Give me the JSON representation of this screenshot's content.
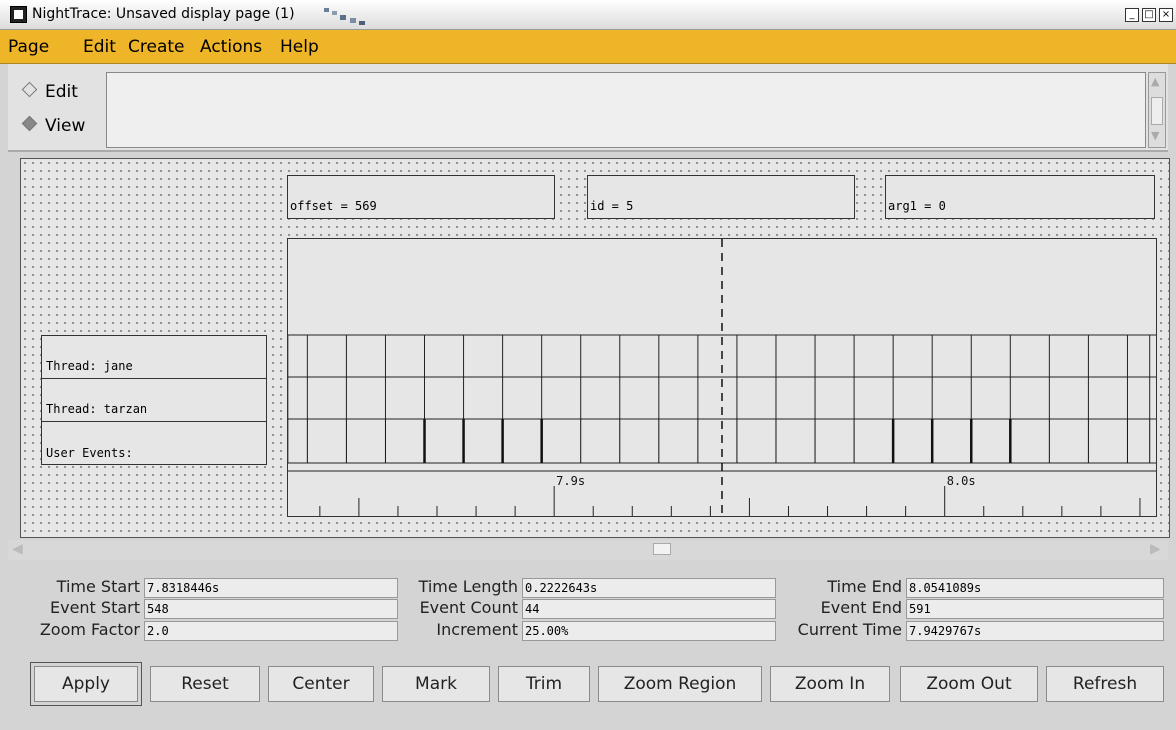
{
  "window": {
    "title": "NightTrace: Unsaved display page (1)",
    "controls": [
      "_",
      "□",
      "×"
    ]
  },
  "menu": [
    "Page",
    "Edit",
    "Create",
    "Actions",
    "Help"
  ],
  "mode": {
    "edit_label": "Edit",
    "view_label": "View",
    "selected": "View"
  },
  "info_boxes": {
    "offset": "offset = 569",
    "id": "id = 5",
    "arg1": "arg1 = 0"
  },
  "rows": [
    "Thread: jane",
    "Thread: tarzan",
    "User Events:"
  ],
  "timeline": {
    "ticks": [
      "7.9s",
      "8.0s"
    ],
    "time_start": 7.8318446,
    "time_end": 8.0541089,
    "current_time": 7.9429767,
    "jane_events": [
      7.8318,
      7.8368,
      7.8468,
      7.8568,
      7.8668,
      7.8768,
      7.8868,
      7.8968,
      7.9068,
      7.9168,
      7.9268,
      7.9368,
      7.9468,
      7.9568,
      7.9668,
      7.9768,
      7.9868,
      7.9968,
      8.0068,
      8.0168,
      8.0268,
      8.0368,
      8.0468,
      8.0525
    ],
    "tarzan_events": [
      7.8318,
      7.8368,
      7.8468,
      7.8568,
      7.8668,
      7.8768,
      7.8868,
      7.8968,
      7.9068,
      7.9168,
      7.9268,
      7.9368,
      7.9468,
      7.9568,
      7.9668,
      7.9768,
      7.9868,
      7.9968,
      8.0068,
      8.0168,
      8.0268,
      8.0368,
      8.0468,
      8.0525
    ],
    "user_events": [
      {
        "t": 7.8318,
        "bold": false
      },
      {
        "t": 7.8368,
        "bold": false
      },
      {
        "t": 7.8468,
        "bold": false
      },
      {
        "t": 7.8568,
        "bold": false
      },
      {
        "t": 7.8668,
        "bold": true
      },
      {
        "t": 7.8768,
        "bold": true
      },
      {
        "t": 7.8868,
        "bold": true
      },
      {
        "t": 7.8968,
        "bold": true
      },
      {
        "t": 7.9068,
        "bold": false
      },
      {
        "t": 7.9168,
        "bold": false
      },
      {
        "t": 7.9268,
        "bold": false
      },
      {
        "t": 7.9368,
        "bold": false
      },
      {
        "t": 7.9468,
        "bold": false
      },
      {
        "t": 7.9568,
        "bold": false
      },
      {
        "t": 7.9668,
        "bold": false
      },
      {
        "t": 7.9768,
        "bold": false
      },
      {
        "t": 7.9868,
        "bold": true
      },
      {
        "t": 7.9968,
        "bold": true
      },
      {
        "t": 8.0068,
        "bold": true
      },
      {
        "t": 8.0168,
        "bold": true
      },
      {
        "t": 8.0268,
        "bold": false
      },
      {
        "t": 8.0368,
        "bold": false
      },
      {
        "t": 8.0468,
        "bold": false
      },
      {
        "t": 8.0525,
        "bold": false
      }
    ]
  },
  "fields": {
    "time_start": {
      "label": "Time Start",
      "value": "7.8318446s"
    },
    "event_start": {
      "label": "Event Start",
      "value": "548"
    },
    "zoom_factor": {
      "label": "Zoom Factor",
      "value": "2.0"
    },
    "time_length": {
      "label": "Time Length",
      "value": "0.2222643s"
    },
    "event_count": {
      "label": "Event Count",
      "value": "44"
    },
    "increment": {
      "label": "Increment",
      "value": "25.00%"
    },
    "time_end": {
      "label": "Time End",
      "value": "8.0541089s"
    },
    "event_end": {
      "label": "Event End",
      "value": "591"
    },
    "current_time": {
      "label": "Current Time",
      "value": "7.9429767s"
    }
  },
  "buttons": [
    "Apply",
    "Reset",
    "Center",
    "Mark",
    "Trim",
    "Zoom Region",
    "Zoom In",
    "Zoom Out",
    "Refresh"
  ],
  "colors": {
    "menubar": "#eeb528",
    "window": "#d4d4d4"
  }
}
